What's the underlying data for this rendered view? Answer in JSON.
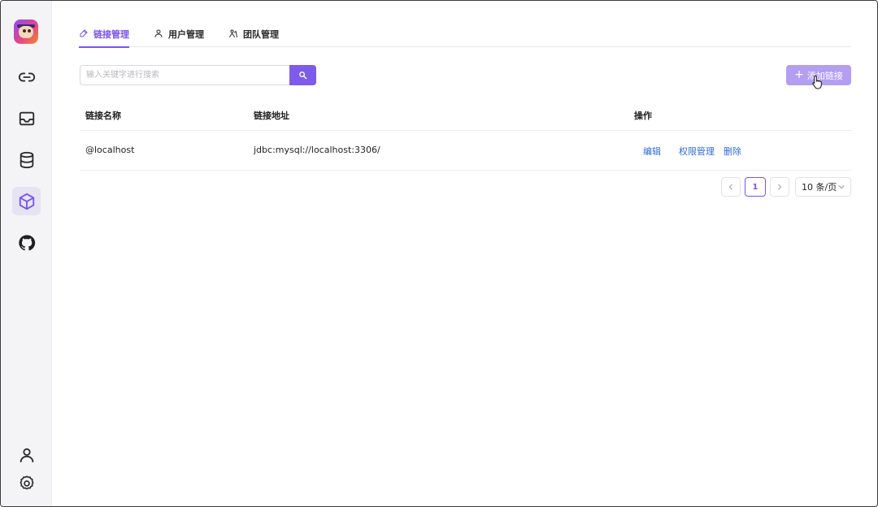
{
  "sidebar": {
    "logo_icon": "app-logo",
    "nav": [
      {
        "icon": "link-icon",
        "active": false
      },
      {
        "icon": "inbox-icon",
        "active": false
      },
      {
        "icon": "database-icon",
        "active": false
      },
      {
        "icon": "cube-icon",
        "active": true
      },
      {
        "icon": "github-icon",
        "active": false
      }
    ],
    "bottom": [
      {
        "icon": "user-icon"
      },
      {
        "icon": "settings-icon"
      }
    ]
  },
  "tabs": [
    {
      "label": "链接管理",
      "icon": "link-edit-icon",
      "active": true
    },
    {
      "label": "用户管理",
      "icon": "user-icon",
      "active": false
    },
    {
      "label": "团队管理",
      "icon": "team-icon",
      "active": false
    }
  ],
  "search": {
    "placeholder": "输入关键字进行搜索",
    "value": "",
    "button_icon": "search-icon"
  },
  "add_button": {
    "label": "添加链接",
    "icon": "plus-icon"
  },
  "table": {
    "columns": [
      "链接名称",
      "链接地址",
      "操作"
    ],
    "rows": [
      {
        "name": "@localhost",
        "url": "jdbc:mysql://localhost:3306/",
        "actions": [
          "编辑",
          "权限管理",
          "删除"
        ]
      }
    ]
  },
  "pagination": {
    "prev_icon": "chevron-left-icon",
    "current_page": "1",
    "next_icon": "chevron-right-icon",
    "page_size": "10 条/页"
  },
  "colors": {
    "accent": "#7a54e6",
    "link": "#2e6ad8",
    "sidebar_bg": "#f4f4f6"
  }
}
